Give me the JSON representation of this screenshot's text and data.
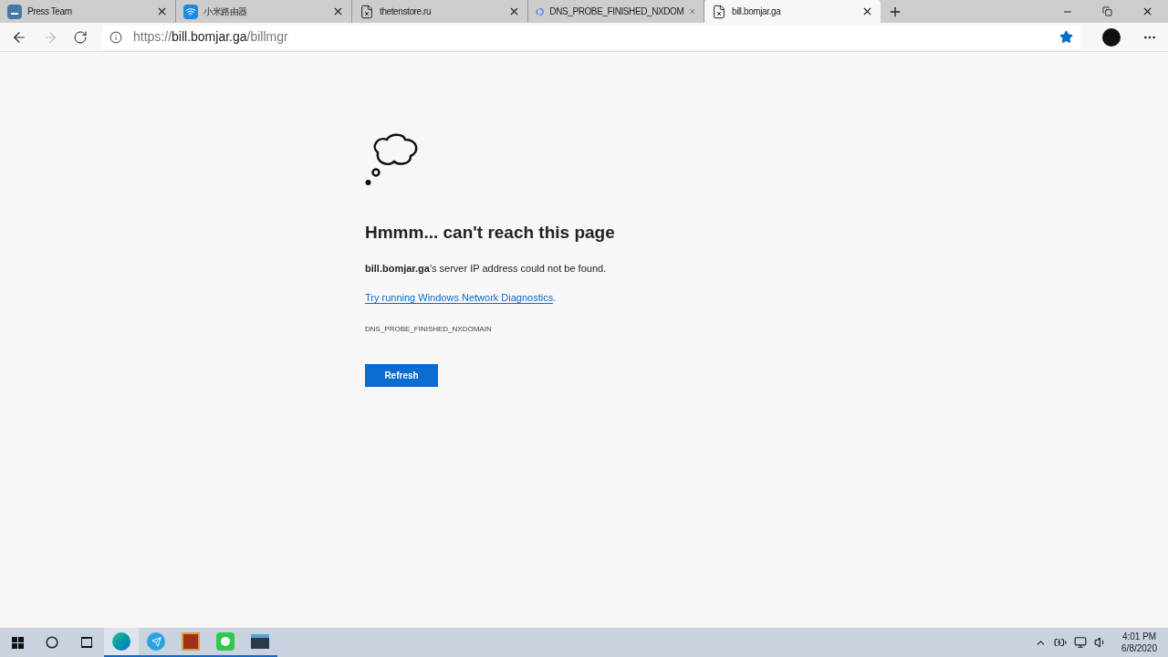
{
  "tabs": [
    {
      "label": "Press Team",
      "kind": "vk",
      "selected": false
    },
    {
      "label": "小米路由器",
      "kind": "wifi",
      "selected": false
    },
    {
      "label": "thetenstore.ru",
      "kind": "page",
      "selected": false
    },
    {
      "label": "DNS_PROBE_FINISHED_NXDOM",
      "kind": "google",
      "selected": false
    },
    {
      "label": "bill.bomjar.ga",
      "kind": "page",
      "selected": true
    }
  ],
  "address_bar": {
    "scheme": "https://",
    "host": "bill.bomjar.ga",
    "path": "/billmgr",
    "favorite": true
  },
  "error_page": {
    "heading": "Hmmm... can't reach this page",
    "message": "**bill.bomjar.ga**'s server IP address could not be found.",
    "link": "Try running Windows Network Diagnostics",
    "link_tail": ".",
    "code": "DNS_PROBE_FINISHED_NXDOMAIN",
    "button": "Refresh"
  },
  "taskbar": {
    "apps": [
      {
        "kind": "edge",
        "running": true,
        "selected": true
      },
      {
        "kind": "telegram",
        "running": true,
        "selected": false
      },
      {
        "kind": "t-app",
        "running": true,
        "selected": false
      },
      {
        "kind": "green-app",
        "running": true,
        "selected": false
      },
      {
        "kind": "terminal",
        "running": true,
        "selected": false
      }
    ],
    "time": "4:01 PM",
    "date": "6/8/2020"
  }
}
